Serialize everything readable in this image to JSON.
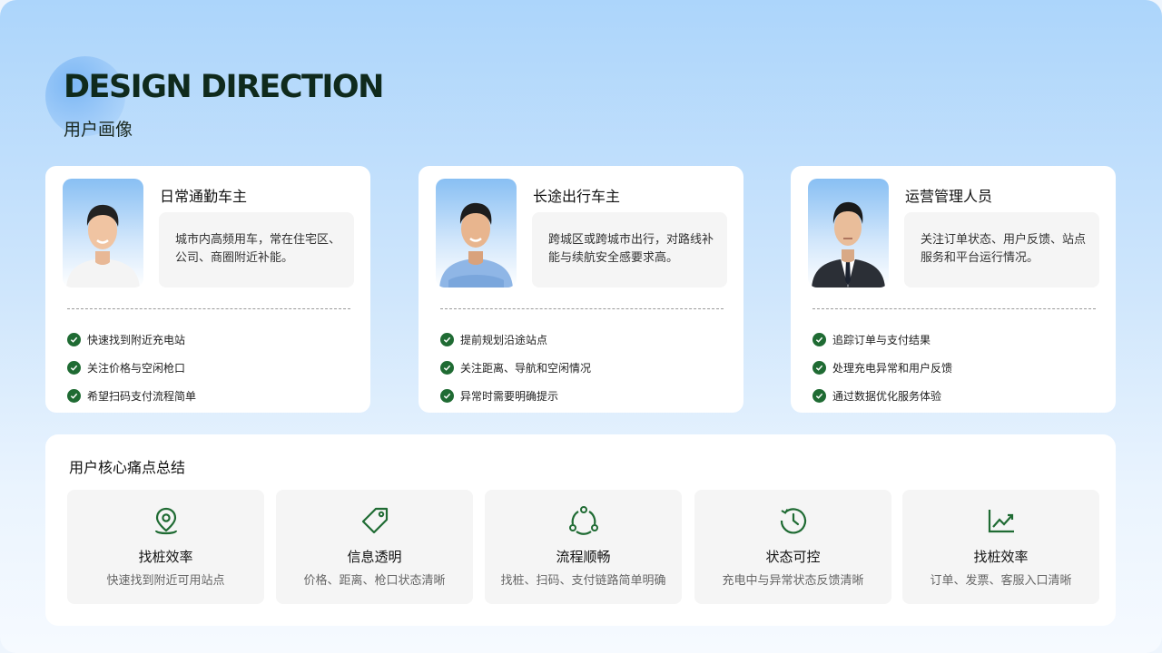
{
  "header": {
    "title": "DESIGN DIRECTION",
    "subtitle": "用户画像"
  },
  "personas": [
    {
      "name": "日常通勤车主",
      "description": "城市内高频用车，常在住宅区、公司、商圈附近补能。",
      "needs": [
        "快速找到附近充电站",
        "关注价格与空闲枪口",
        "希望扫码支付流程简单"
      ]
    },
    {
      "name": "长途出行车主",
      "description": "跨城区或跨城市出行，对路线补能与续航安全感要求高。",
      "needs": [
        "提前规划沿途站点",
        "关注距离、导航和空闲情况",
        "异常时需要明确提示"
      ]
    },
    {
      "name": "运营管理人员",
      "description": "关注订单状态、用户反馈、站点服务和平台运行情况。",
      "needs": [
        "追踪订单与支付结果",
        "处理充电异常和用户反馈",
        "通过数据优化服务体验"
      ]
    }
  ],
  "summary": {
    "title": "用户核心痛点总结",
    "items": [
      {
        "icon": "location-pin-icon",
        "name": "找桩效率",
        "desc": "快速找到附近可用站点"
      },
      {
        "icon": "price-tag-icon",
        "name": "信息透明",
        "desc": "价格、距离、枪口状态清晰"
      },
      {
        "icon": "cycle-flow-icon",
        "name": "流程顺畅",
        "desc": "找桩、扫码、支付链路简单明确"
      },
      {
        "icon": "clock-history-icon",
        "name": "状态可控",
        "desc": "充电中与异常状态反馈清晰"
      },
      {
        "icon": "trend-chart-icon",
        "name": "找桩效率",
        "desc": "订单、发票、客服入口清晰"
      }
    ]
  },
  "colors": {
    "accent_green": "#1f6b33",
    "background_blue": "#acd5fb"
  }
}
